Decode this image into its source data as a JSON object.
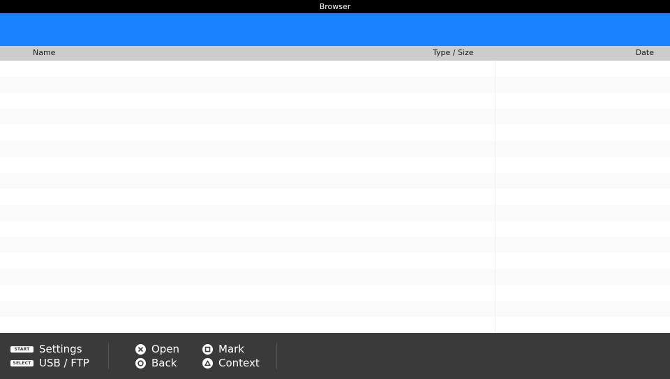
{
  "window": {
    "title": "Browser"
  },
  "path": {
    "value": ""
  },
  "columns": {
    "name": "Name",
    "type_size": "Type / Size",
    "date": "Date"
  },
  "file_list": {
    "rows": 17
  },
  "footer": {
    "start_badge": "START",
    "settings_label": "Settings",
    "select_badge": "SELECT",
    "usb_ftp_label": "USB / FTP",
    "open_label": "Open",
    "back_label": "Back",
    "mark_label": "Mark",
    "context_label": "Context"
  },
  "colors": {
    "titlebar": "#000000",
    "pathbar": "#1a82ff",
    "header": "#cccccc",
    "footer": "#3a3a3a"
  }
}
